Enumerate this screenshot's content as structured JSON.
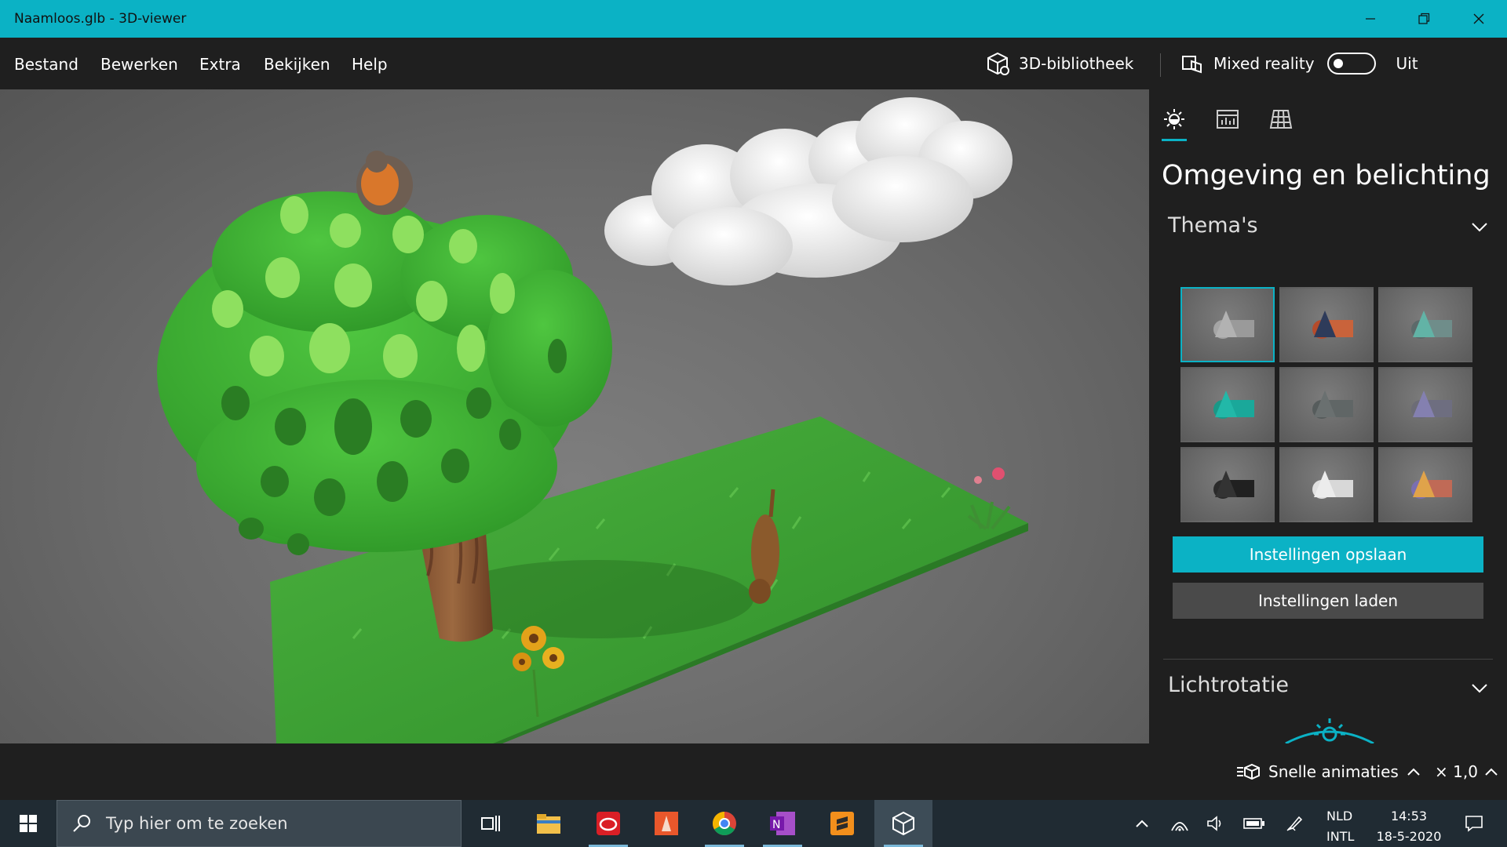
{
  "window": {
    "title": "Naamloos.glb - 3D-viewer"
  },
  "menu": {
    "items": [
      "Bestand",
      "Bewerken",
      "Extra",
      "Bekijken",
      "Help"
    ]
  },
  "toolbar": {
    "library_label": "3D-bibliotheek",
    "mixed_reality_label": "Mixed reality",
    "toggle_state": "Uit"
  },
  "panel": {
    "title": "Omgeving en belichting",
    "themes_label": "Thema's",
    "save_button": "Instellingen opslaan",
    "load_button": "Instellingen laden",
    "light_rotation_label": "Lichtrotatie"
  },
  "bottom": {
    "animations_label": "Snelle animaties",
    "speed_label": "× 1,0"
  },
  "taskbar": {
    "search_placeholder": "Typ hier om te zoeken",
    "lang_top": "NLD",
    "lang_bottom": "INTL",
    "time": "14:53",
    "date": "18-5-2020"
  },
  "colors": {
    "accent": "#0bb2c5",
    "panel_bg": "#1f1f1f",
    "taskbar_bg": "#202b33"
  }
}
